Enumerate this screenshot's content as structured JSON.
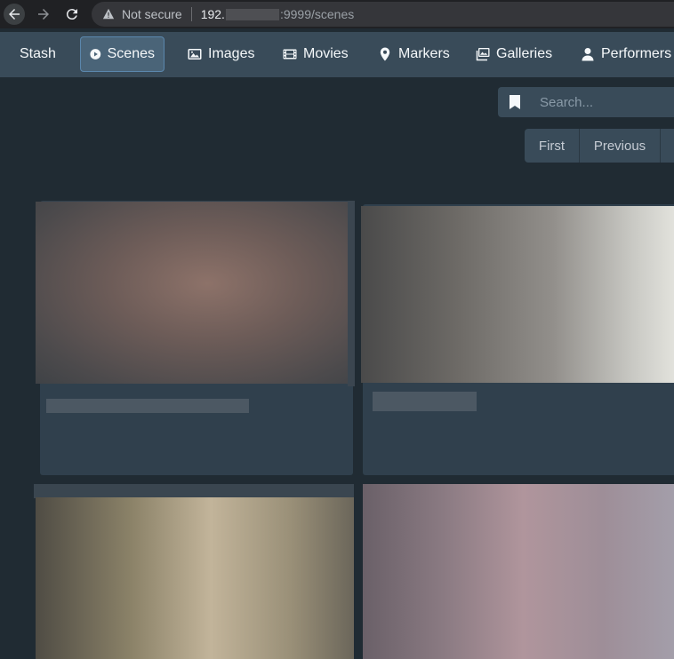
{
  "browser": {
    "security_label": "Not secure",
    "url_host": "192.",
    "url_path": ":9999/scenes"
  },
  "navbar": {
    "brand": "Stash",
    "items": [
      {
        "label": "Scenes",
        "icon": "play-circle-icon"
      },
      {
        "label": "Images",
        "icon": "image-icon"
      },
      {
        "label": "Movies",
        "icon": "film-icon"
      },
      {
        "label": "Markers",
        "icon": "map-marker-icon"
      },
      {
        "label": "Galleries",
        "icon": "images-icon"
      },
      {
        "label": "Performers",
        "icon": "user-icon"
      }
    ]
  },
  "search": {
    "placeholder": "Search..."
  },
  "pagination": {
    "first": "First",
    "previous": "Previous"
  },
  "colors": {
    "background": "#202b33",
    "navbar": "#394b59",
    "card": "#30404d",
    "active_nav": "#4a6478"
  }
}
